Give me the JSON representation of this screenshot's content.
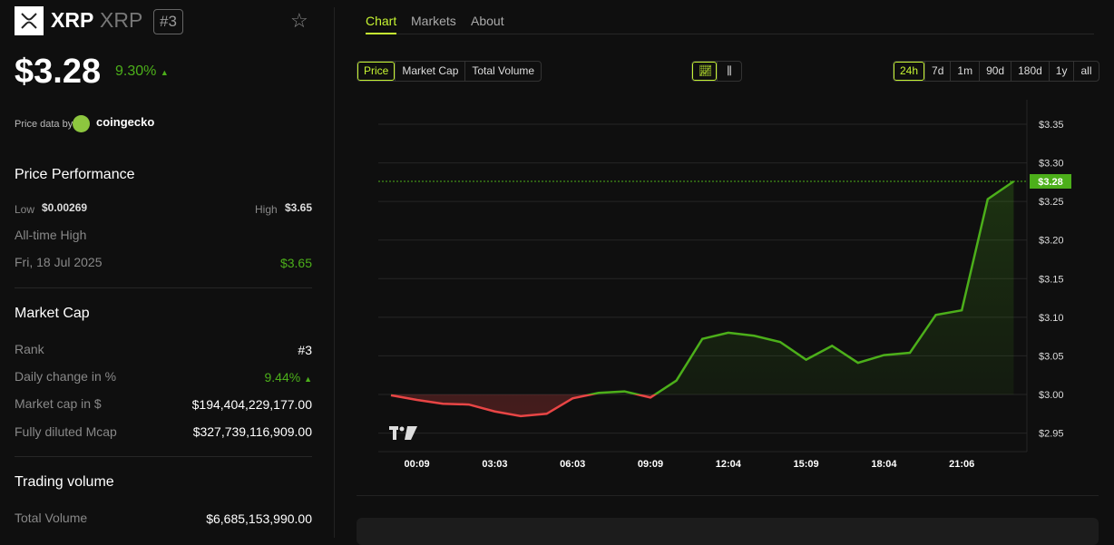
{
  "coin": {
    "name": "XRP",
    "symbol": "XRP",
    "rank": "#3",
    "price": "$3.28",
    "change": "9.30%",
    "change_arrow": "▲",
    "logo_icon": "xrp-logo"
  },
  "attribution": {
    "label": "Price data by",
    "provider": "coingecko"
  },
  "performance": {
    "title": "Price Performance",
    "low_label": "Low",
    "low": "$0.00269",
    "high_label": "High",
    "high": "$3.65",
    "ath_label": "All-time High",
    "ath_date": "Fri, 18 Jul 2025",
    "ath": "$3.65"
  },
  "market_cap": {
    "title": "Market Cap",
    "rank_label": "Rank",
    "rank": "#3",
    "daily_label": "Daily change in %",
    "daily": "9.44%",
    "daily_arrow": "▲",
    "mcap_label": "Market cap in $",
    "mcap": "$194,404,229,177.00",
    "fdv_label": "Fully diluted Mcap",
    "fdv": "$327,739,116,909.00"
  },
  "volume": {
    "title": "Trading volume",
    "total_label": "Total Volume",
    "total": "$6,685,153,990.00"
  },
  "tabs": [
    "Chart",
    "Markets",
    "About"
  ],
  "metric_buttons": [
    "Price",
    "Market Cap",
    "Total Volume"
  ],
  "range_buttons": [
    "24h",
    "7d",
    "1m",
    "90d",
    "180d",
    "1y",
    "all"
  ],
  "colors": {
    "accent": "#c6f432",
    "up": "#4caf1a",
    "down": "#e84545"
  },
  "chart_data": {
    "type": "line",
    "ylim": [
      2.925,
      3.375
    ],
    "yticks": [
      2.95,
      3.0,
      3.05,
      3.1,
      3.15,
      3.2,
      3.25,
      3.3,
      3.35
    ],
    "ytick_labels": [
      "$2.95",
      "$3.00",
      "$3.05",
      "$3.10",
      "$3.15",
      "$3.20",
      "$3.25",
      "$3.30",
      "$3.35"
    ],
    "baseline": 3.0,
    "xtick_labels": [
      "00:09",
      "03:03",
      "06:03",
      "09:09",
      "12:04",
      "15:09",
      "18:04",
      "21:06"
    ],
    "xtick_index": [
      1,
      4,
      7,
      10,
      13,
      16,
      19,
      22
    ],
    "values": [
      2.999,
      2.993,
      2.988,
      2.987,
      2.978,
      2.972,
      2.975,
      2.995,
      3.002,
      3.004,
      2.996,
      3.018,
      3.072,
      3.08,
      3.076,
      3.068,
      3.045,
      3.063,
      3.041,
      3.051,
      3.054,
      3.103,
      3.109,
      3.253,
      3.276
    ],
    "current_price_label": "$3.28",
    "grid": true
  }
}
